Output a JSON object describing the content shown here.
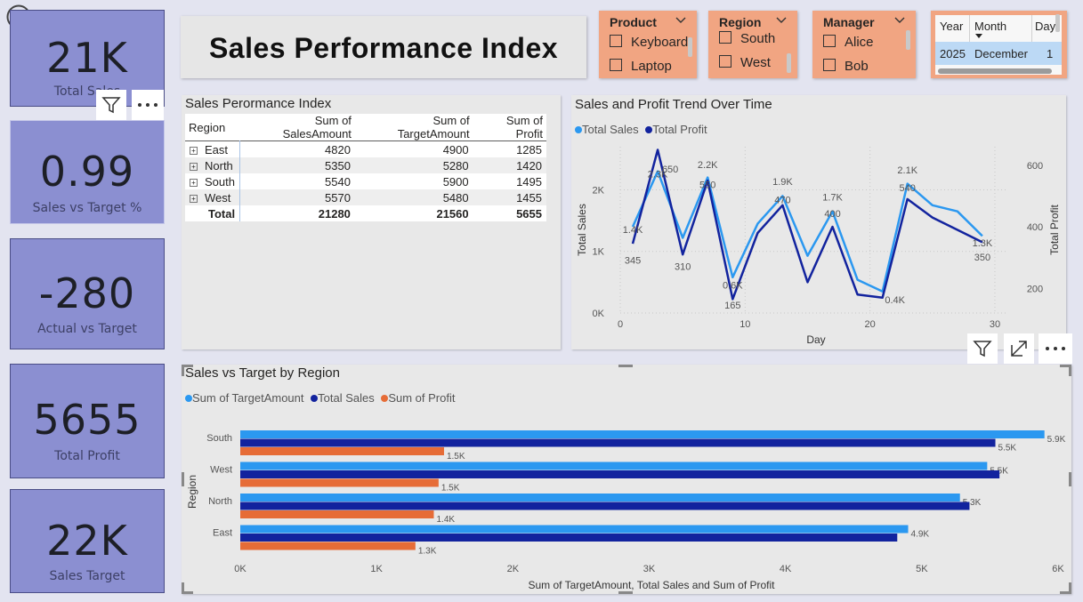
{
  "cards": [
    {
      "value": "21K",
      "label": "Total Sales"
    },
    {
      "value": "0.99",
      "label": "Sales vs Target %"
    },
    {
      "value": "-280",
      "label": "Actual vs Target"
    },
    {
      "value": "5655",
      "label": "Total Profit"
    },
    {
      "value": "22K",
      "label": "Sales Target"
    }
  ],
  "page_title": "Sales Performance Index",
  "slicers": {
    "product": {
      "title": "Product",
      "options": [
        "Keyboard",
        "Laptop"
      ]
    },
    "region": {
      "title": "Region",
      "options": [
        "South",
        "West"
      ]
    },
    "manager": {
      "title": "Manager",
      "options": [
        "Alice",
        "Bob"
      ]
    },
    "date": {
      "headers": [
        "Year",
        "Month",
        "Day"
      ],
      "row": [
        "2025",
        "December",
        "1"
      ]
    }
  },
  "matrix": {
    "title": "Sales Perormance Index",
    "headers": [
      "Region",
      "Sum of SalesAmount",
      "Sum of TargetAmount",
      "Sum of Profit"
    ],
    "rows": [
      {
        "region": "East",
        "sales": "4820",
        "target": "4900",
        "profit": "1285"
      },
      {
        "region": "North",
        "sales": "5350",
        "target": "5280",
        "profit": "1420"
      },
      {
        "region": "South",
        "sales": "5540",
        "target": "5900",
        "profit": "1495"
      },
      {
        "region": "West",
        "sales": "5570",
        "target": "5480",
        "profit": "1455"
      }
    ],
    "total": {
      "region": "Total",
      "sales": "21280",
      "target": "21560",
      "profit": "5655"
    }
  },
  "chart_data": [
    {
      "type": "line",
      "title": "Sales and Profit Trend Over Time",
      "xlabel": "Day",
      "ylabel": "Total Sales",
      "y2label": "Total Profit",
      "xlim": [
        0,
        31
      ],
      "xticks": [
        "0",
        "10",
        "20",
        "30"
      ],
      "ylim": [
        0,
        2700
      ],
      "yticks": [
        "0K",
        "1K",
        "2K"
      ],
      "y2lim": [
        120,
        660
      ],
      "y2ticks": [
        "200",
        "400",
        "600"
      ],
      "legend_position": "top-left",
      "grid": true,
      "colors": {
        "sales": "#2b98f0",
        "profit": "#12239e"
      },
      "x": [
        1,
        3,
        5,
        7,
        9,
        11,
        13,
        15,
        17,
        19,
        21,
        23,
        25,
        27,
        29
      ],
      "series": [
        {
          "name": "Total Sales",
          "axis": "left",
          "values": [
            1400,
            2300,
            1220,
            2200,
            580,
            1450,
            1900,
            930,
            1650,
            540,
            350,
            2100,
            1750,
            1650,
            1250
          ]
        },
        {
          "name": "Total Profit",
          "axis": "right",
          "values": [
            345,
            650,
            310,
            550,
            165,
            380,
            470,
            220,
            400,
            180,
            170,
            490,
            430,
            390,
            350
          ]
        }
      ],
      "data_labels": [
        {
          "text": "1.4K",
          "x": 1,
          "y": 1300,
          "axis": "left"
        },
        {
          "text": "2.3K",
          "x": 3,
          "y": 2200,
          "axis": "left"
        },
        {
          "text": "650",
          "x": 4,
          "y": 2280,
          "axis": "left"
        },
        {
          "text": "2.2K",
          "x": 7,
          "y": 2350,
          "axis": "left"
        },
        {
          "text": "550",
          "x": 7,
          "y": 2030,
          "axis": "left"
        },
        {
          "text": "0.6K",
          "x": 9,
          "y": 400,
          "axis": "left"
        },
        {
          "text": "1.9K",
          "x": 13,
          "y": 2080,
          "axis": "left"
        },
        {
          "text": "470",
          "x": 13,
          "y": 1780,
          "axis": "left"
        },
        {
          "text": "1.7K",
          "x": 17,
          "y": 1830,
          "axis": "left"
        },
        {
          "text": "400",
          "x": 17,
          "y": 1560,
          "axis": "left"
        },
        {
          "text": "0.4K",
          "x": 22,
          "y": 160,
          "axis": "left"
        },
        {
          "text": "2.1K",
          "x": 23,
          "y": 2270,
          "axis": "left"
        },
        {
          "text": "540",
          "x": 23,
          "y": 1980,
          "axis": "left"
        },
        {
          "text": "1.3K",
          "x": 29,
          "y": 1080,
          "axis": "left"
        },
        {
          "text": "345",
          "x": 1,
          "y": 800,
          "axis": "left"
        },
        {
          "text": "310",
          "x": 5,
          "y": 700,
          "axis": "left"
        },
        {
          "text": "165",
          "x": 9,
          "y": 70,
          "axis": "left"
        },
        {
          "text": "350",
          "x": 29,
          "y": 850,
          "axis": "left"
        }
      ]
    },
    {
      "type": "bar",
      "orientation": "horizontal",
      "title": "Sales vs Target by Region",
      "xlabel": "Sum of TargetAmount, Total Sales and Sum of Profit",
      "ylabel": "Region",
      "categories": [
        "South",
        "West",
        "North",
        "East"
      ],
      "xlim": [
        0,
        6000
      ],
      "xticks": [
        "0K",
        "1K",
        "2K",
        "3K",
        "4K",
        "5K",
        "6K"
      ],
      "legend_position": "top-left",
      "grid": false,
      "colors": {
        "target": "#2b98f0",
        "sales": "#12239e",
        "profit": "#e66c37"
      },
      "series": [
        {
          "name": "Sum of TargetAmount",
          "values": [
            5900,
            5480,
            5280,
            4900
          ],
          "labels": [
            "5.9K",
            "5.5K",
            "5.3K",
            "4.9K"
          ]
        },
        {
          "name": "Total Sales",
          "values": [
            5540,
            5570,
            5350,
            4820
          ],
          "labels": [
            "5.5K",
            "",
            "",
            ""
          ]
        },
        {
          "name": "Sum of Profit",
          "values": [
            1495,
            1455,
            1420,
            1285
          ],
          "labels": [
            "1.5K",
            "1.5K",
            "1.4K",
            "1.3K"
          ]
        }
      ]
    }
  ]
}
